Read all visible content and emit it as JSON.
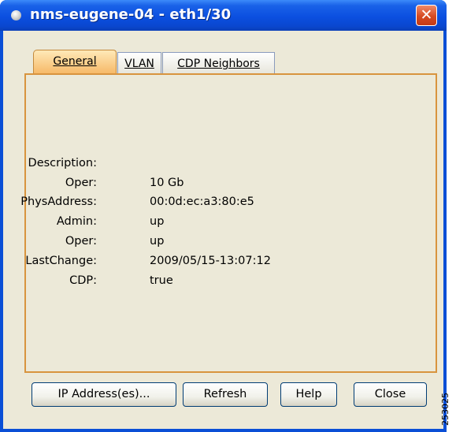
{
  "window": {
    "title": "nms-eugene-04 - eth1/30",
    "close_glyph": "✕"
  },
  "tabs": [
    {
      "label": "General",
      "active": true
    },
    {
      "label": "VLAN",
      "active": false
    },
    {
      "label": "CDP Neighbors",
      "active": false
    }
  ],
  "general": {
    "fields": [
      {
        "label": "Description:",
        "value": ""
      },
      {
        "label": "Oper:",
        "value": "10 Gb"
      },
      {
        "label": "PhysAddress:",
        "value": "00:0d:ec:a3:80:e5"
      },
      {
        "label": "Admin:",
        "value": "up"
      },
      {
        "label": "Oper:",
        "value": "up"
      },
      {
        "label": "LastChange:",
        "value": "2009/05/15-13:07:12"
      },
      {
        "label": "CDP:",
        "value": "true"
      }
    ]
  },
  "buttons": {
    "ip_address": "IP Address(es)...",
    "refresh": "Refresh",
    "help": "Help",
    "close": "Close"
  },
  "figure_id": "253025",
  "colors": {
    "titlebar": "#0a4fd6",
    "active_tab": "#f6b866",
    "panel_border": "#d8943e",
    "close_button": "#d64a22",
    "window_bg": "#ece9d8"
  }
}
